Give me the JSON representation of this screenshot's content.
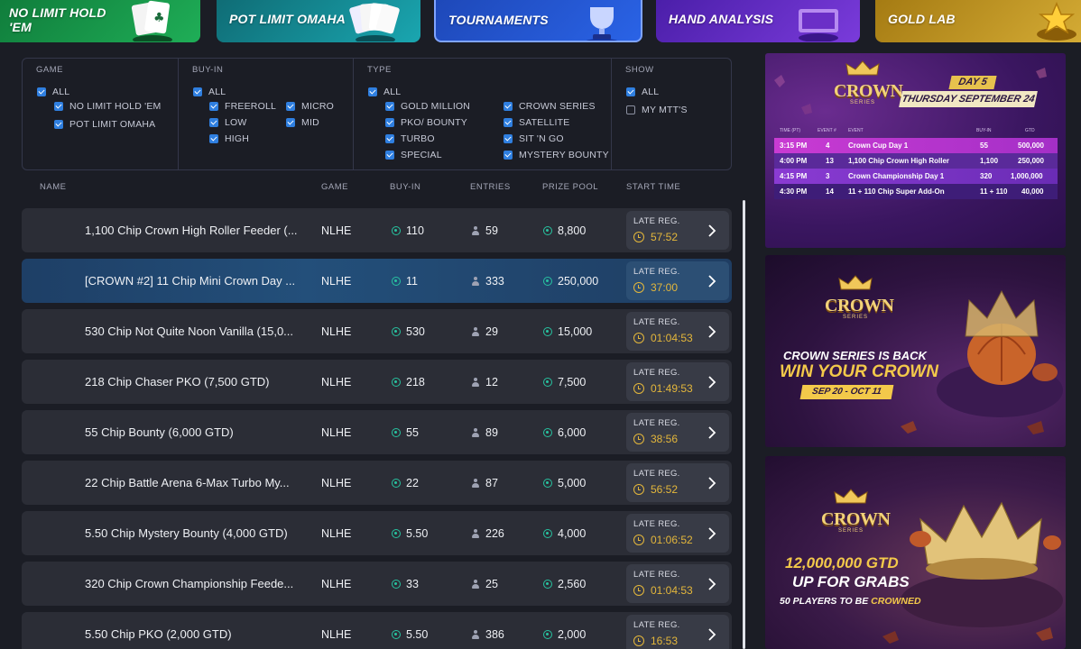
{
  "tabs": [
    {
      "label": "NO LIMIT HOLD 'EM",
      "icon": "playing-cards-icon"
    },
    {
      "label": "POT LIMIT OMAHA",
      "icon": "playing-cards-icon"
    },
    {
      "label": "TOURNAMENTS",
      "icon": "trophy-icon",
      "active": true
    },
    {
      "label": "HAND ANALYSIS",
      "icon": "podium-icon"
    },
    {
      "label": "GOLD LAB",
      "icon": "star-icon"
    }
  ],
  "filters": {
    "game": {
      "header": "GAME",
      "options": [
        "ALL",
        "NO LIMIT HOLD 'EM",
        "POT LIMIT OMAHA"
      ]
    },
    "buyin": {
      "header": "BUY-IN",
      "options": [
        "ALL",
        "FREEROLL",
        "LOW",
        "HIGH",
        "MICRO",
        "MID"
      ]
    },
    "type": {
      "header": "TYPE",
      "options": [
        "ALL",
        "GOLD MILLION",
        "PKO/ BOUNTY",
        "TURBO",
        "SPECIAL",
        "CROWN SERIES",
        "SATELLITE",
        "SIT 'N GO",
        "MYSTERY BOUNTY"
      ]
    },
    "show": {
      "header": "SHOW",
      "options": [
        "ALL",
        "MY MTT'S"
      ]
    }
  },
  "columns": {
    "name": "NAME",
    "game": "GAME",
    "buyin": "BUY-IN",
    "entries": "ENTRIES",
    "prize": "PRIZE POOL",
    "start": "START TIME"
  },
  "rows": [
    {
      "name": "1,100 Chip Crown High Roller Feeder (...",
      "game": "NLHE",
      "buyin": "110",
      "entries": "59",
      "prize": "8,800",
      "status": "LATE REG.",
      "time": "57:52"
    },
    {
      "name": "[CROWN #2] 11 Chip Mini Crown Day ...",
      "game": "NLHE",
      "buyin": "11",
      "entries": "333",
      "prize": "250,000",
      "status": "LATE REG.",
      "time": "37:00"
    },
    {
      "name": "530 Chip Not Quite Noon Vanilla (15,0...",
      "game": "NLHE",
      "buyin": "530",
      "entries": "29",
      "prize": "15,000",
      "status": "LATE REG.",
      "time": "01:04:53"
    },
    {
      "name": "218 Chip Chaser PKO (7,500 GTD)",
      "game": "NLHE",
      "buyin": "218",
      "entries": "12",
      "prize": "7,500",
      "status": "LATE REG.",
      "time": "01:49:53"
    },
    {
      "name": "55 Chip Bounty (6,000 GTD)",
      "game": "NLHE",
      "buyin": "55",
      "entries": "89",
      "prize": "6,000",
      "status": "LATE REG.",
      "time": "38:56"
    },
    {
      "name": "22 Chip Battle Arena 6-Max Turbo My...",
      "game": "NLHE",
      "buyin": "22",
      "entries": "87",
      "prize": "5,000",
      "status": "LATE REG.",
      "time": "56:52"
    },
    {
      "name": "5.50 Chip Mystery Bounty (4,000 GTD)",
      "game": "NLHE",
      "buyin": "5.50",
      "entries": "226",
      "prize": "4,000",
      "status": "LATE REG.",
      "time": "01:06:52"
    },
    {
      "name": "320 Chip Crown Championship Feede...",
      "game": "NLHE",
      "buyin": "33",
      "entries": "25",
      "prize": "2,560",
      "status": "LATE REG.",
      "time": "01:04:53"
    },
    {
      "name": "5.50 Chip PKO (2,000 GTD)",
      "game": "NLHE",
      "buyin": "5.50",
      "entries": "386",
      "prize": "2,000",
      "status": "LATE REG.",
      "time": "16:53"
    }
  ],
  "promos": {
    "day": {
      "crest": "CROWN",
      "crest_sub": "SERIES",
      "day_label": "DAY 5",
      "date": "THURSDAY SEPTEMBER 24",
      "columns": [
        "TIME (PT)",
        "EVENT #",
        "EVENT",
        "BUY-IN",
        "GTD"
      ],
      "events": [
        {
          "time": "3:15 PM",
          "num": "4",
          "event": "Crown Cup Day 1",
          "buyin": "55",
          "gtd": "500,000"
        },
        {
          "time": "4:00 PM",
          "num": "13",
          "event": "1,100 Chip Crown High Roller",
          "buyin": "1,100",
          "gtd": "250,000"
        },
        {
          "time": "4:15 PM",
          "num": "3",
          "event": "Crown Championship Day 1",
          "buyin": "320",
          "gtd": "1,000,000"
        },
        {
          "time": "4:30 PM",
          "num": "14",
          "event": "11 + 110 Chip Super Add-On",
          "buyin": "11 + 110",
          "gtd": "40,000"
        }
      ]
    },
    "back": {
      "crest": "CROWN",
      "crest_sub": "SERIES",
      "line1": "CROWN SERIES IS BACK",
      "line2": "WIN YOUR CROWN",
      "dates": "SEP 20 - OCT 11"
    },
    "gtd": {
      "crest": "CROWN",
      "crest_sub": "SERIES",
      "line1": "12,000,000 GTD",
      "line2": "UP FOR GRABS",
      "line3a": "50 PLAYERS TO BE",
      "line3b": "CROWNED"
    }
  },
  "colors": {
    "accent": "#2f7fe0",
    "coin": "#27c3a0",
    "clock": "#e4b73b",
    "gold": "#f3c94a"
  }
}
